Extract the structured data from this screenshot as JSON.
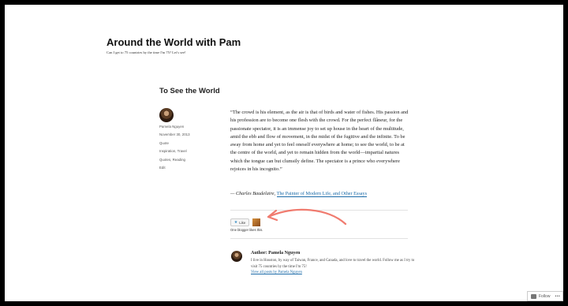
{
  "site": {
    "title": "Around the World with Pam",
    "description": "Can I get to 75 countries by the time I'm 75? Let's see!"
  },
  "post": {
    "title": "To See the World",
    "meta": {
      "author": "Pamela Nguyen",
      "date": "November 30, 2013",
      "format": "Quote",
      "categories": "Inspiration, Travel",
      "tags": "Quotes, Reading",
      "edit": "Edit"
    },
    "quote": "“The crowd is his element, as the air is that of birds and water of fishes. His passion and his profession are to become one flesh with the crowd. For the perfect flâneur, for the passionate spectator, it is an immense joy to set up house in the heart of the multitude, amid the ebb and flow of movement, in the midst of the fugitive and the infinite. To be away from home and yet to feel oneself everywhere at home; to see the world, to be at the centre of the world, and yet to remain hidden from the world—impartial natures which the tongue can but clumsily define. The spectator is a prince who everywhere rejoices in his incognito.”",
    "citation_prefix": "— Charles Baudelaire,",
    "citation_link": "The Painter of Modern Life, and Other Essays"
  },
  "likes": {
    "button_label": "Like",
    "text": "One blogger likes this."
  },
  "author_box": {
    "heading": "Author: Pamela Nguyen",
    "bio": "I live in Houston, by way of Taiwan, France, and Canada, and love to travel the world. Follow me as I try to visit 75 countries by the time I'm 75!",
    "link": "View all posts by Pamela Nguyen"
  },
  "follow": {
    "label": "Follow",
    "more": "•••"
  },
  "colors": {
    "link": "#1b6ba8",
    "arrow": "#f07b6f"
  }
}
